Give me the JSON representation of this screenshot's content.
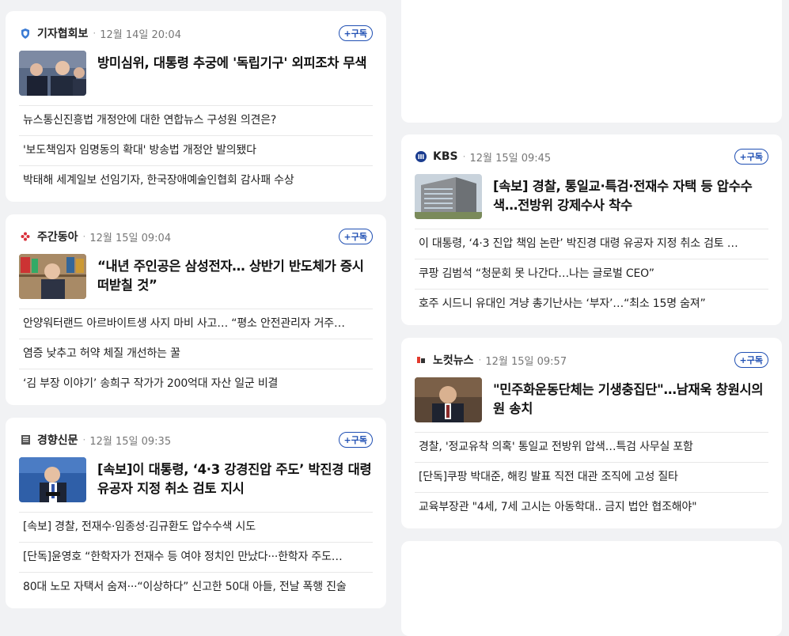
{
  "subscribe_label": "+구독",
  "left_cards": [
    {
      "press": "기자협회보",
      "time": "12월 14일 20:04",
      "logo_icon": "shield-icon",
      "logo_color": "#3b7bd4",
      "headline": "방미심위, 대통령 추궁에 '독립기구' 외피조차 무색",
      "items": [
        "뉴스통신진흥법 개정안에 대한 연합뉴스 구성원 의견은?",
        "'보도책임자 임명동의 확대' 방송법 개정안 발의됐다",
        "박태해 세계일보 선임기자, 한국장애예술인협회 감사패 수상"
      ]
    },
    {
      "press": "주간동아",
      "time": "12월 15일 09:04",
      "logo_icon": "flower-icon",
      "logo_color": "#d9303a",
      "headline": "“내년 주인공은 삼성전자… 상반기 반도체가 증시 떠받칠 것”",
      "items": [
        "안양워터랜드 아르바이트생 사지 마비 사고… “평소 안전관리자 거주…",
        "염증 낮추고 허약 체질 개선하는 꿀",
        "‘김 부장 이야기’ 송희구 작가가 200억대 자산 일군 비결"
      ]
    },
    {
      "press": "경향신문",
      "time": "12월 15일 09:35",
      "logo_icon": "newspaper-icon",
      "logo_color": "#555555",
      "headline": "[속보]이 대통령, ‘4·3 강경진압 주도’ 박진경 대령 유공자 지정 취소 검토 지시",
      "items": [
        "[속보] 경찰, 전재수·임종성·김규환도 압수수색 시도",
        "[단독]윤영호 “한학자가 전재수 등 여야 정치인 만났다···한학자 주도…",
        "80대 노모 자택서 숨져···“이상하다” 신고한 50대 아들, 전날 폭행 진술"
      ]
    }
  ],
  "right_cards": [
    {
      "press": "KBS",
      "time": "12월 15일 09:45",
      "logo_icon": "kbs-logo-icon",
      "logo_color": "#1a3c8f",
      "headline": "[속보] 경찰, 통일교·특검·전재수 자택 등 압수수색…전방위 강제수사 착수",
      "items": [
        "이 대통령, ‘4·3 진압 책임 논란’ 박진경 대령 유공자 지정 취소 검토 …",
        "쿠팡 김범석 “청문회 못 나간다…나는 글로벌 CEO”",
        "호주 시드니 유대인 겨냥 총기난사는 ‘부자’…“최소 15명 숨져”"
      ]
    },
    {
      "press": "노컷뉴스",
      "time": "12월 15일 09:57",
      "logo_icon": "nocut-logo-icon",
      "logo_color": "#e23b2e",
      "headline": "\"민주화운동단체는 기생충집단\"…남재욱 창원시의원 송치",
      "items": [
        "경찰, '정교유착 의혹' 통일교 전방위 압색…특검 사무실 포함",
        "[단독]쿠팡 박대준, 해킹 발표 직전 대관 조직에 고성 질타",
        "교육부장관 \"4세, 7세 고시는 아동학대.. 금지 법안 협조해야\""
      ]
    }
  ]
}
